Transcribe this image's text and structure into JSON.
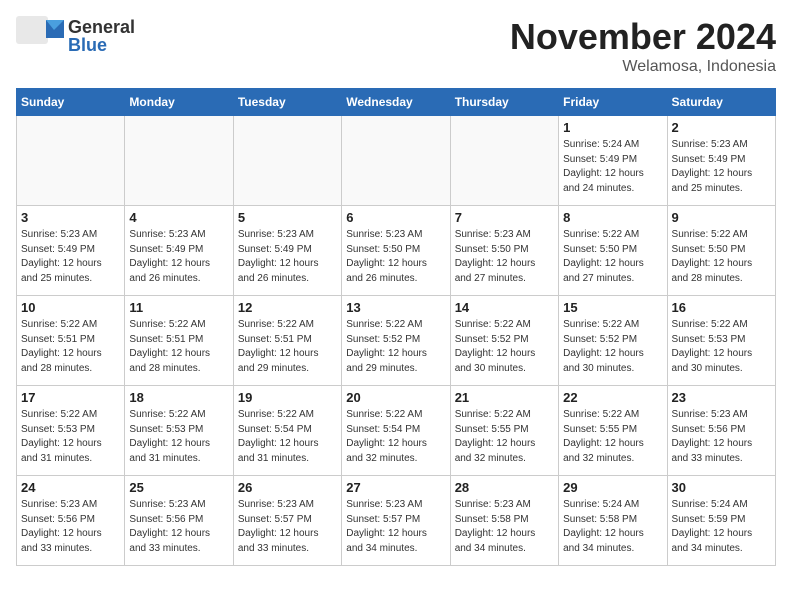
{
  "logo": {
    "general": "General",
    "blue": "Blue"
  },
  "title": "November 2024",
  "location": "Welamosa, Indonesia",
  "weekdays": [
    "Sunday",
    "Monday",
    "Tuesday",
    "Wednesday",
    "Thursday",
    "Friday",
    "Saturday"
  ],
  "weeks": [
    [
      {
        "day": "",
        "info": ""
      },
      {
        "day": "",
        "info": ""
      },
      {
        "day": "",
        "info": ""
      },
      {
        "day": "",
        "info": ""
      },
      {
        "day": "",
        "info": ""
      },
      {
        "day": "1",
        "info": "Sunrise: 5:24 AM\nSunset: 5:49 PM\nDaylight: 12 hours\nand 24 minutes."
      },
      {
        "day": "2",
        "info": "Sunrise: 5:23 AM\nSunset: 5:49 PM\nDaylight: 12 hours\nand 25 minutes."
      }
    ],
    [
      {
        "day": "3",
        "info": "Sunrise: 5:23 AM\nSunset: 5:49 PM\nDaylight: 12 hours\nand 25 minutes."
      },
      {
        "day": "4",
        "info": "Sunrise: 5:23 AM\nSunset: 5:49 PM\nDaylight: 12 hours\nand 26 minutes."
      },
      {
        "day": "5",
        "info": "Sunrise: 5:23 AM\nSunset: 5:49 PM\nDaylight: 12 hours\nand 26 minutes."
      },
      {
        "day": "6",
        "info": "Sunrise: 5:23 AM\nSunset: 5:50 PM\nDaylight: 12 hours\nand 26 minutes."
      },
      {
        "day": "7",
        "info": "Sunrise: 5:23 AM\nSunset: 5:50 PM\nDaylight: 12 hours\nand 27 minutes."
      },
      {
        "day": "8",
        "info": "Sunrise: 5:22 AM\nSunset: 5:50 PM\nDaylight: 12 hours\nand 27 minutes."
      },
      {
        "day": "9",
        "info": "Sunrise: 5:22 AM\nSunset: 5:50 PM\nDaylight: 12 hours\nand 28 minutes."
      }
    ],
    [
      {
        "day": "10",
        "info": "Sunrise: 5:22 AM\nSunset: 5:51 PM\nDaylight: 12 hours\nand 28 minutes."
      },
      {
        "day": "11",
        "info": "Sunrise: 5:22 AM\nSunset: 5:51 PM\nDaylight: 12 hours\nand 28 minutes."
      },
      {
        "day": "12",
        "info": "Sunrise: 5:22 AM\nSunset: 5:51 PM\nDaylight: 12 hours\nand 29 minutes."
      },
      {
        "day": "13",
        "info": "Sunrise: 5:22 AM\nSunset: 5:52 PM\nDaylight: 12 hours\nand 29 minutes."
      },
      {
        "day": "14",
        "info": "Sunrise: 5:22 AM\nSunset: 5:52 PM\nDaylight: 12 hours\nand 30 minutes."
      },
      {
        "day": "15",
        "info": "Sunrise: 5:22 AM\nSunset: 5:52 PM\nDaylight: 12 hours\nand 30 minutes."
      },
      {
        "day": "16",
        "info": "Sunrise: 5:22 AM\nSunset: 5:53 PM\nDaylight: 12 hours\nand 30 minutes."
      }
    ],
    [
      {
        "day": "17",
        "info": "Sunrise: 5:22 AM\nSunset: 5:53 PM\nDaylight: 12 hours\nand 31 minutes."
      },
      {
        "day": "18",
        "info": "Sunrise: 5:22 AM\nSunset: 5:53 PM\nDaylight: 12 hours\nand 31 minutes."
      },
      {
        "day": "19",
        "info": "Sunrise: 5:22 AM\nSunset: 5:54 PM\nDaylight: 12 hours\nand 31 minutes."
      },
      {
        "day": "20",
        "info": "Sunrise: 5:22 AM\nSunset: 5:54 PM\nDaylight: 12 hours\nand 32 minutes."
      },
      {
        "day": "21",
        "info": "Sunrise: 5:22 AM\nSunset: 5:55 PM\nDaylight: 12 hours\nand 32 minutes."
      },
      {
        "day": "22",
        "info": "Sunrise: 5:22 AM\nSunset: 5:55 PM\nDaylight: 12 hours\nand 32 minutes."
      },
      {
        "day": "23",
        "info": "Sunrise: 5:23 AM\nSunset: 5:56 PM\nDaylight: 12 hours\nand 33 minutes."
      }
    ],
    [
      {
        "day": "24",
        "info": "Sunrise: 5:23 AM\nSunset: 5:56 PM\nDaylight: 12 hours\nand 33 minutes."
      },
      {
        "day": "25",
        "info": "Sunrise: 5:23 AM\nSunset: 5:56 PM\nDaylight: 12 hours\nand 33 minutes."
      },
      {
        "day": "26",
        "info": "Sunrise: 5:23 AM\nSunset: 5:57 PM\nDaylight: 12 hours\nand 33 minutes."
      },
      {
        "day": "27",
        "info": "Sunrise: 5:23 AM\nSunset: 5:57 PM\nDaylight: 12 hours\nand 34 minutes."
      },
      {
        "day": "28",
        "info": "Sunrise: 5:23 AM\nSunset: 5:58 PM\nDaylight: 12 hours\nand 34 minutes."
      },
      {
        "day": "29",
        "info": "Sunrise: 5:24 AM\nSunset: 5:58 PM\nDaylight: 12 hours\nand 34 minutes."
      },
      {
        "day": "30",
        "info": "Sunrise: 5:24 AM\nSunset: 5:59 PM\nDaylight: 12 hours\nand 34 minutes."
      }
    ]
  ]
}
